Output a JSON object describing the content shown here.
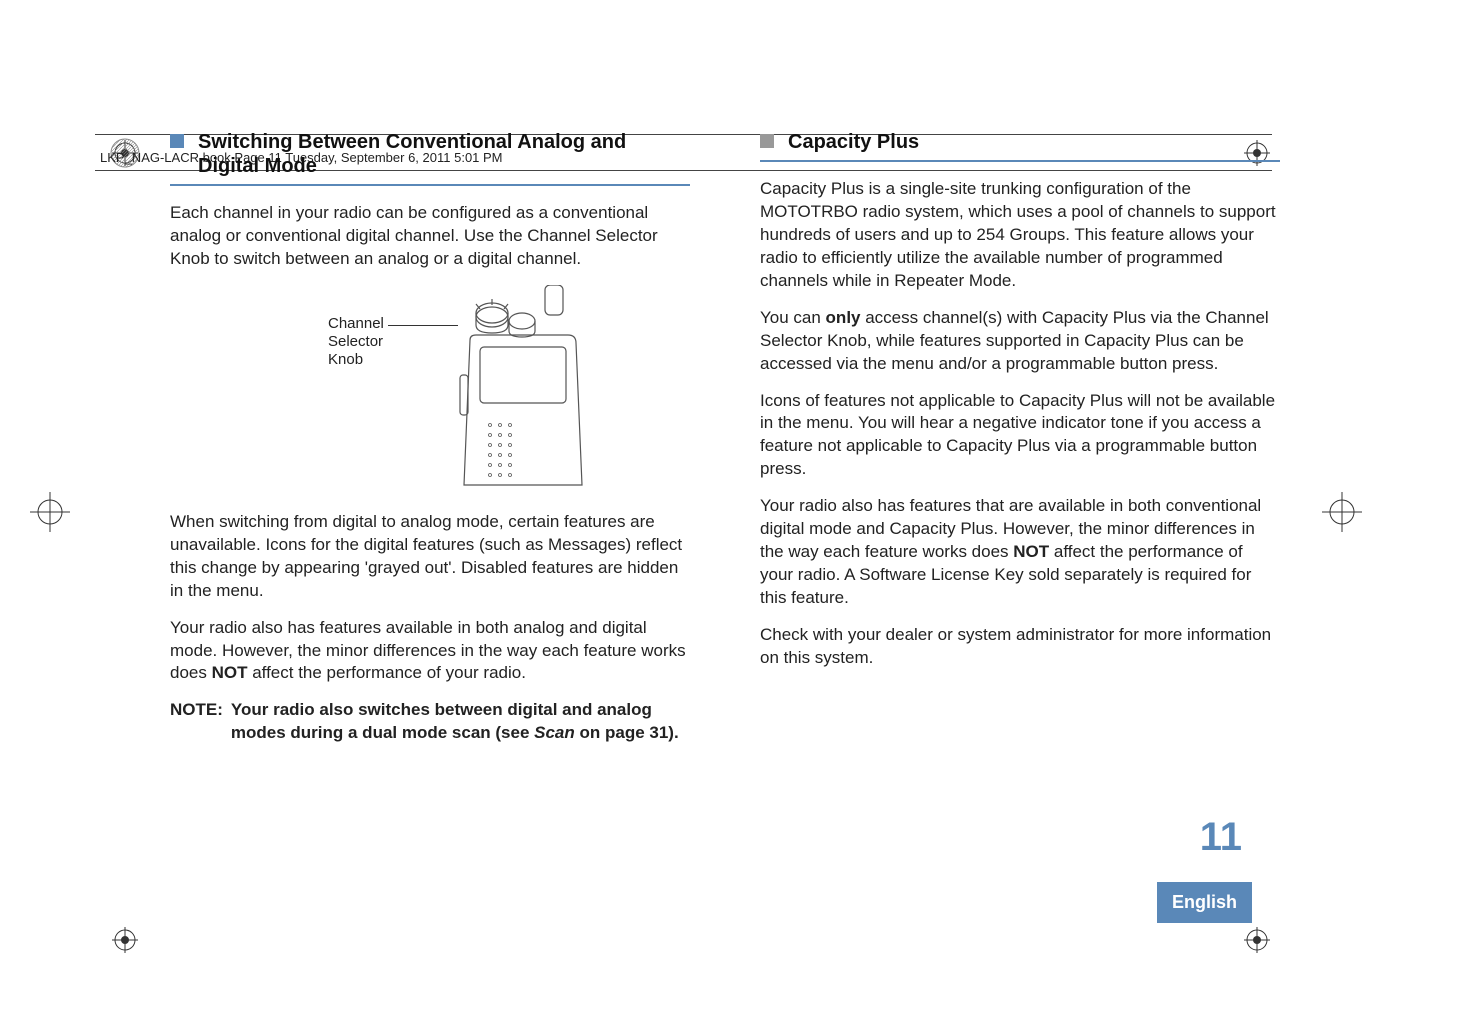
{
  "header": {
    "running_head": "LKP_NAG-LACR.book  Page 11  Tuesday, September 6, 2011  5:01 PM"
  },
  "left": {
    "heading": "Switching Between Conventional Analog and Digital Mode",
    "p1": "Each channel in your radio can be configured as a conventional analog or conventional digital channel. Use the Channel Selector Knob to switch between an analog or a digital channel.",
    "figure_label_l1": "Channel",
    "figure_label_l2": "Selector",
    "figure_label_l3": "Knob",
    "p2": "When switching from digital to analog mode, certain features are unavailable. Icons for the digital features (such as Messages) reflect this change by appearing 'grayed out'. Disabled features are hidden in the menu.",
    "p3_a": "Your radio also has features available in both analog and digital mode. However, the minor differences in the way each feature works does ",
    "p3_not": "NOT",
    "p3_b": " affect the performance of your radio.",
    "note_label": "NOTE:",
    "note_a": "Your radio also switches between digital and analog modes during a dual mode scan (see ",
    "note_scan": "Scan",
    "note_b": " on page 31)."
  },
  "right": {
    "heading": "Capacity Plus",
    "p1": "Capacity Plus is a single-site trunking configuration of the MOTOTRBO radio system, which uses a pool of channels to support hundreds of users and up to 254 Groups. This feature allows your radio to efficiently utilize the available number of programmed channels while in Repeater Mode.",
    "p2_a": "You can ",
    "p2_only": "only",
    "p2_b": " access channel(s) with Capacity Plus via the Channel Selector Knob, while features supported in Capacity Plus can be accessed via the menu and/or a programmable button press.",
    "p3": "Icons of features not applicable to Capacity Plus will not be available in the menu. You will hear a negative indicator tone if you access a feature not applicable to Capacity Plus via a programmable button press.",
    "p4_a": "Your radio also has features that are available in both conventional digital mode and Capacity Plus. However, the minor differences in the way each feature works does ",
    "p4_not": "NOT",
    "p4_b": " affect the performance of your radio. A Software License Key sold separately is required for this feature.",
    "p5": "Check with your dealer or system administrator for more information on this system."
  },
  "footer": {
    "page_number": "11",
    "language": "English"
  }
}
